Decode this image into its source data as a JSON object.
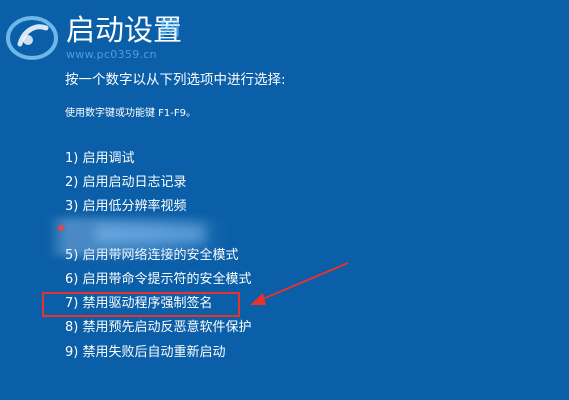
{
  "title": "启动设置",
  "subtitle": "按一个数字以从下列选项中进行选择:",
  "hint": "使用数字键或功能键 F1-F9。",
  "options": [
    "1) 启用调试",
    "2) 启用启动日志记录",
    "3) 启用低分辨率视频",
    "",
    "5) 启用带网络连接的安全模式",
    "6) 启用带命令提示符的安全模式",
    "7) 禁用驱动程序强制签名",
    "8) 禁用预先启动反恶意软件保护",
    "9) 禁用失败后自动重新启动"
  ],
  "highlighted_option_index": 6,
  "watermark": {
    "name": "网",
    "url": "www.pc0359.cn"
  },
  "colors": {
    "background": "#0b5fa8",
    "text": "#ffffff",
    "highlight": "#e8322e"
  }
}
